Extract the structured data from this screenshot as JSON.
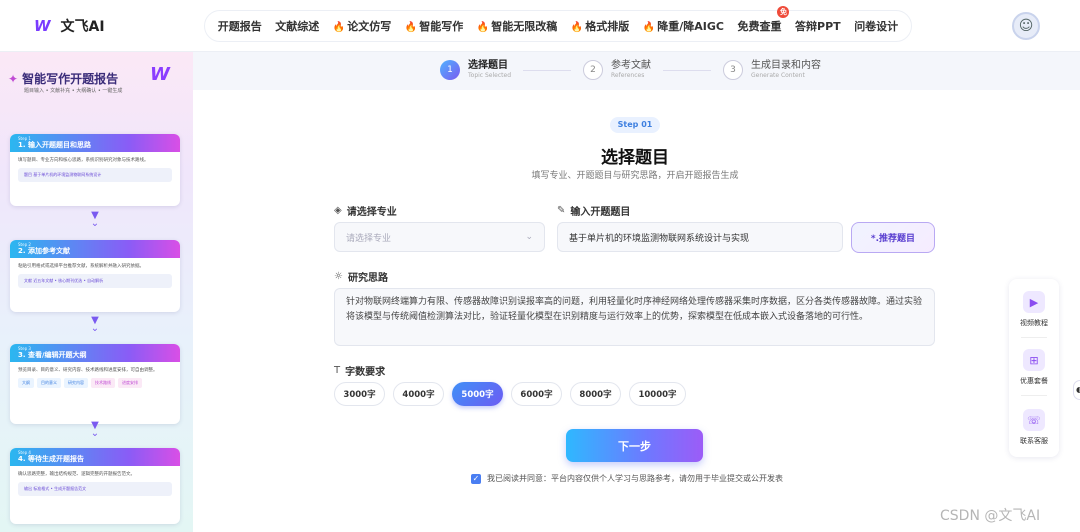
{
  "brand": {
    "logo_mark": "W",
    "name": "文飞AI"
  },
  "nav": [
    {
      "label": "开题报告",
      "hot": false
    },
    {
      "label": "文献综述",
      "hot": false
    },
    {
      "label": "论文仿写",
      "hot": true
    },
    {
      "label": "智能写作",
      "hot": true
    },
    {
      "label": "智能无限改稿",
      "hot": true
    },
    {
      "label": "格式排版",
      "hot": true
    },
    {
      "label": "降重/降AIGC",
      "hot": true
    },
    {
      "label": "免费查重",
      "hot": false,
      "badge": "免"
    },
    {
      "label": "答辩PPT",
      "hot": false
    },
    {
      "label": "问卷设计",
      "hot": false
    }
  ],
  "sidebar": {
    "title": "智能写作开题报告",
    "subtitle": "题目输入 • 文献补充 • 大纲确认 • 一键生成",
    "logo_mark": "W",
    "cards": [
      {
        "step": "Step 1",
        "title": "1. 输入开题题目和思路",
        "desc": "填写题目、专业方向和核心思路，系统识别研究对象与技术路线。",
        "tag": "题目  基于单片机的环境监测物联网系统设计"
      },
      {
        "step": "Step 2",
        "title": "2. 添加参考文献",
        "desc": "粘贴引用格式或选择平台推荐文献，系统解析并融入研究依据。",
        "tag": "文献  近五年文献 • 核心期刊优选 • 自动解析"
      },
      {
        "step": "Step 3",
        "title": "3. 查看/编辑开题大纲",
        "desc": "预览目录、目的意义、研究内容、技术路线和进度安排，可自由调整。",
        "chips": [
          "目的意义",
          "研究内容",
          "技术路线",
          "进度安排"
        ],
        "chips_label": "大纲"
      },
      {
        "step": "Step 4",
        "title": "4. 等待生成开题报告",
        "desc": "确认思路完整，输出结构规范、逻辑完整的开题报告范文。",
        "tag": "输出  标准格式 • 生成开题报告范文"
      }
    ]
  },
  "stepper": [
    {
      "num": "1",
      "title": "选择题目",
      "en": "Topic Selected",
      "active": true
    },
    {
      "num": "2",
      "title": "参考文献",
      "en": "References",
      "active": false
    },
    {
      "num": "3",
      "title": "生成目录和内容",
      "en": "Generate Content",
      "active": false
    }
  ],
  "form": {
    "step_pill": "Step 01",
    "heading": "选择题目",
    "subheading": "填写专业、开题题目与研究思路，开启开题报告生成",
    "major_label": "请选择专业",
    "major_placeholder": "请选择专业",
    "topic_label": "输入开题题目",
    "topic_value": "基于单片机的环境监测物联网系统设计与实现",
    "recommend_button": "*.推荐题目",
    "idea_label": "研究思路",
    "idea_value": "针对物联网终端算力有限、传感器故障识别误报率高的问题，利用轻量化时序神经网络处理传感器采集时序数据，区分各类传感器故障。通过实验将该模型与传统阈值检测算法对比，验证轻量化模型在识别精度与运行效率上的优势，探索模型在低成本嵌入式设备落地的可行性。",
    "count_label": "字数要求",
    "counts": [
      "3000字",
      "4000字",
      "5000字",
      "6000字",
      "8000字",
      "10000字"
    ],
    "count_selected": "5000字",
    "next_button": "下一步",
    "agree_text": "我已阅读并同意：平台内容仅供个人学习与思路参考，请勿用于毕业提交或公开发表"
  },
  "right_panel": [
    {
      "icon": "video-icon",
      "label": "视频教程"
    },
    {
      "icon": "gift-icon",
      "label": "优惠套餐"
    },
    {
      "icon": "headset-icon",
      "label": "联系客服"
    }
  ],
  "watermark": "CSDN @文飞AI"
}
